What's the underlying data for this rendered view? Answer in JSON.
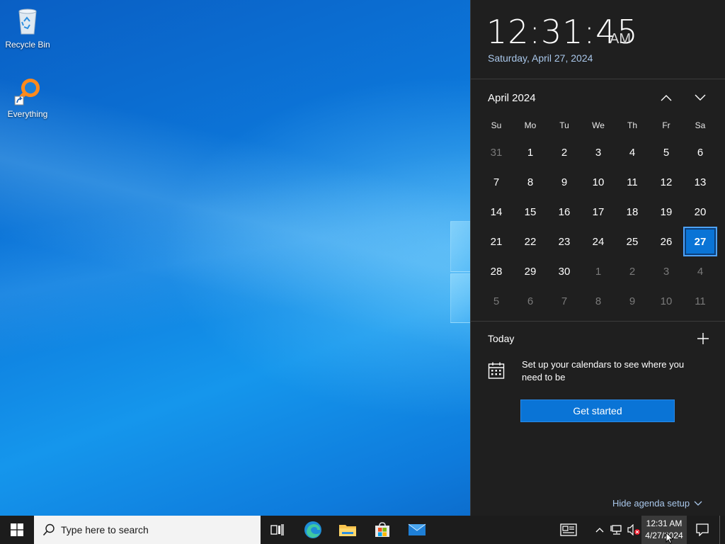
{
  "desktop": {
    "icons": [
      {
        "label": "Recycle Bin",
        "icon": "recycle-bin-icon"
      },
      {
        "label": "Everything",
        "icon": "everything-search-icon"
      }
    ]
  },
  "flyout": {
    "time": "12:31:45",
    "ampm": "AM",
    "long_date": "Saturday, April 27, 2024",
    "month_label": "April 2024",
    "weekdays": [
      "Su",
      "Mo",
      "Tu",
      "We",
      "Th",
      "Fr",
      "Sa"
    ],
    "weeks": [
      [
        "31",
        "1",
        "2",
        "3",
        "4",
        "5",
        "6"
      ],
      [
        "7",
        "8",
        "9",
        "10",
        "11",
        "12",
        "13"
      ],
      [
        "14",
        "15",
        "16",
        "17",
        "18",
        "19",
        "20"
      ],
      [
        "21",
        "22",
        "23",
        "24",
        "25",
        "26",
        "27"
      ],
      [
        "28",
        "29",
        "30",
        "1",
        "2",
        "3",
        "4"
      ],
      [
        "5",
        "6",
        "7",
        "8",
        "9",
        "10",
        "11"
      ]
    ],
    "today_label": "Today",
    "agenda_text": "Set up your calendars to see where you need to be",
    "get_started_label": "Get started",
    "hide_agenda_label": "Hide agenda setup"
  },
  "taskbar": {
    "search_placeholder": "Type here to search",
    "apps": [
      "task-view-icon",
      "edge-icon",
      "file-explorer-icon",
      "microsoft-store-icon",
      "mail-icon"
    ],
    "tray_time": "12:31 AM",
    "tray_date": "4/27/2024"
  },
  "colors": {
    "accent": "#0a74d6",
    "flyout_bg": "#1f1f1f",
    "taskbar_bg": "#1c1c1c",
    "link": "#a9c7ea"
  }
}
